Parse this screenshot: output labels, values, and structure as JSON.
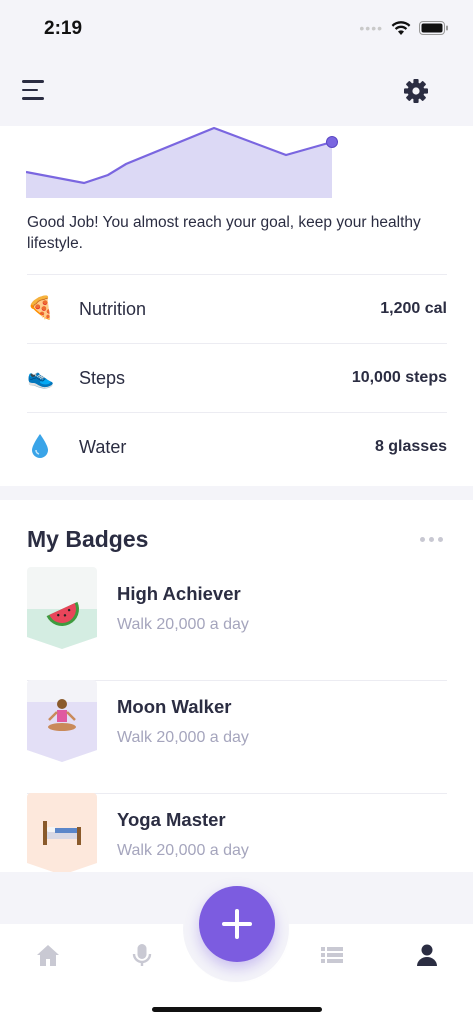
{
  "status_bar": {
    "time": "2:19"
  },
  "colors": {
    "accent": "#7c5ce0",
    "chart_line": "#7a66e0",
    "chart_fill": "#dcd9f5",
    "muted_text": "#a5a5bd"
  },
  "header": {
    "menu_icon": "hamburger-menu-icon",
    "settings_icon": "gear-icon"
  },
  "summary": {
    "message": "Good Job! You almost reach your goal, keep your healthy lifestyle.",
    "stats": [
      {
        "icon": "pizza-icon",
        "label": "Nutrition",
        "value": "1,200 cal"
      },
      {
        "icon": "sneaker-icon",
        "label": "Steps",
        "value": "10,000 steps"
      },
      {
        "icon": "water-drop-icon",
        "label": "Water",
        "value": "8 glasses"
      }
    ]
  },
  "badges": {
    "title": "My Badges",
    "items": [
      {
        "name": "High Achiever",
        "desc": "Walk 20,000 a day",
        "icon": "watermelon-icon"
      },
      {
        "name": "Moon Walker",
        "desc": "Walk 20,000 a day",
        "icon": "yoga-person-icon"
      },
      {
        "name": "Yoga Master",
        "desc": "Walk 20,000 a day",
        "icon": "bed-icon"
      }
    ]
  },
  "bottom_nav": {
    "items": [
      "home-icon",
      "microphone-icon",
      "list-icon",
      "profile-icon"
    ],
    "active": "profile-icon",
    "fab_icon": "plus-icon"
  }
}
